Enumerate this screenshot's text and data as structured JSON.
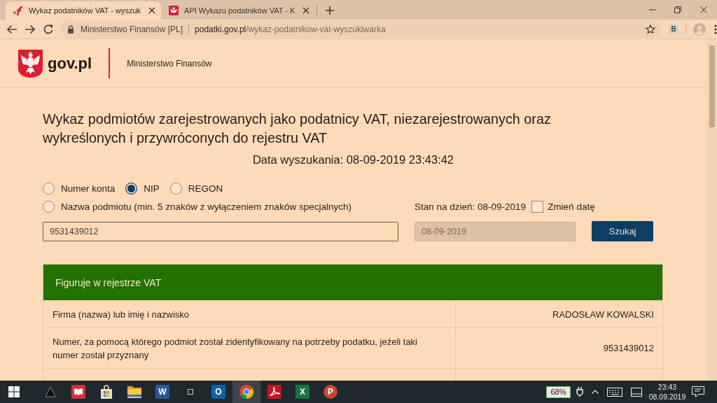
{
  "browser": {
    "tabs": [
      {
        "title": "Wykaz podatników VAT - wyszuk",
        "kind": "mf-logo",
        "selected": true
      },
      {
        "title": "API Wykazu podatników VAT - K",
        "kind": "emblem",
        "selected": false
      }
    ],
    "address_bar": {
      "site_identity": "Ministerstwo Finansów [PL]",
      "host": "podatki.gov.pl",
      "path": "/wykaz-podatnikow-vat-wyszukiwarka"
    },
    "extension": {
      "glyph": "B"
    }
  },
  "header": {
    "logo_text": "gov.pl",
    "ministry": "Ministerstwo Finansów"
  },
  "search": {
    "title": "Wykaz podmiotów zarejestrowanych jako podatnicy VAT, niezarejestrowanych oraz wykreślonych i przywróconych do rejestru VAT",
    "search_date": "Data wyszukania: 08-09-2019 23:43:42",
    "radio_rows": [
      [
        {
          "label": "Numer konta",
          "selected": false
        },
        {
          "label": "NIP",
          "selected": true
        },
        {
          "label": "REGON",
          "selected": false
        }
      ],
      [
        {
          "label": "Nazwa podmiotu (min. 5 znaków z wyłączeniem znaków specjalnych)",
          "selected": false
        }
      ]
    ],
    "state_date_label": "Stan na dzień: 08-09-2019",
    "change_date": {
      "label": "Zmień datę",
      "checked": false
    },
    "query": {
      "value": "9531439012"
    },
    "date_field": {
      "value": "08-09-2019",
      "disabled": true
    },
    "button": "Szukaj"
  },
  "result": {
    "status": "Figuruje w rejestrze VAT",
    "rows": [
      {
        "label": "Firma (nazwa) lub imię i nazwisko",
        "value": "RADOSŁAW KOWALSKI"
      },
      {
        "label": "Numer, za pomocą którego podmiot został zidentyfikowany na potrzeby podatku, jeżeli taki numer został przyznany",
        "value": "9531439012"
      }
    ]
  },
  "taskbar": {
    "apps": [
      {
        "kind": "cone",
        "selected": false
      },
      {
        "kind": "book",
        "selected": false
      },
      {
        "kind": "store",
        "selected": false
      },
      {
        "kind": "folder",
        "selected": false
      },
      {
        "kind": "word",
        "glyph": "W",
        "selected": false
      },
      {
        "kind": "square",
        "selected": false
      },
      {
        "kind": "outlook",
        "glyph": "O",
        "selected": false
      },
      {
        "kind": "chrome",
        "selected": true
      },
      {
        "kind": "pdf",
        "selected": false
      },
      {
        "kind": "excel",
        "glyph": "X",
        "selected": false
      },
      {
        "kind": "powerpoint",
        "glyph": "P",
        "selected": false
      }
    ],
    "battery": "68%",
    "time": "23:43",
    "date": "08.09.2019"
  }
}
